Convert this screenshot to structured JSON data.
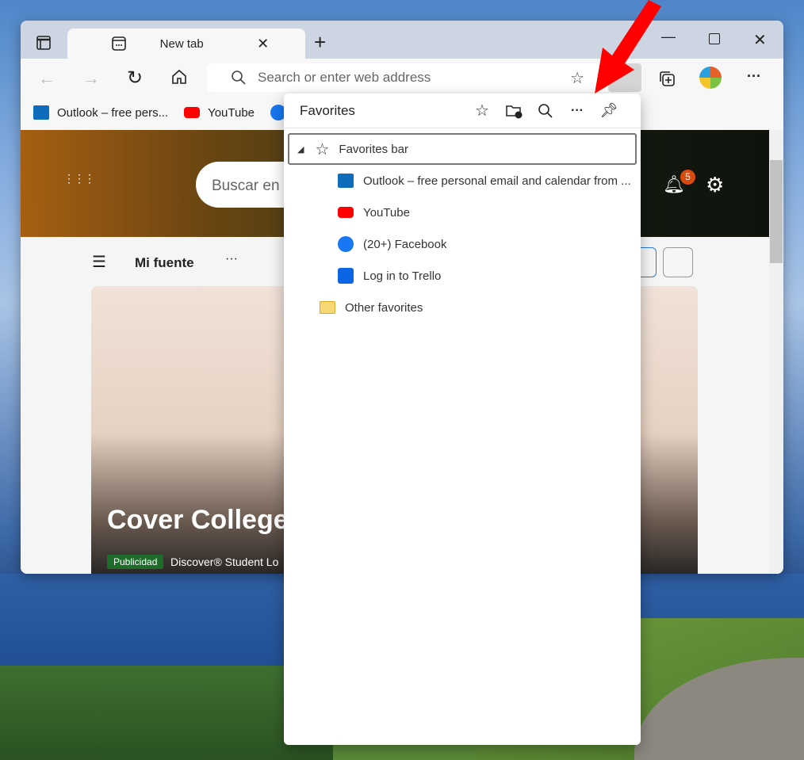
{
  "tab": {
    "title": "New tab"
  },
  "address": {
    "placeholder": "Search or enter web address"
  },
  "favorites_bar": [
    {
      "label": "Outlook – free pers..."
    },
    {
      "label": "YouTube"
    }
  ],
  "page": {
    "search_placeholder": "Buscar en",
    "feed_title": "Mi fuente",
    "notifications": "5",
    "card_title": "Cover College",
    "ad_badge": "Publicidad",
    "ad_source": "Discover® Student Lo"
  },
  "favorites_panel": {
    "title": "Favorites",
    "folder": "Favorites bar",
    "items": [
      {
        "label": "Outlook – free personal email and calendar from ...",
        "icon": "outlook-icon"
      },
      {
        "label": "YouTube",
        "icon": "youtube-icon"
      },
      {
        "label": "(20+) Facebook",
        "icon": "facebook-icon"
      },
      {
        "label": "Log in to Trello",
        "icon": "trello-icon"
      }
    ],
    "other": "Other favorites"
  }
}
